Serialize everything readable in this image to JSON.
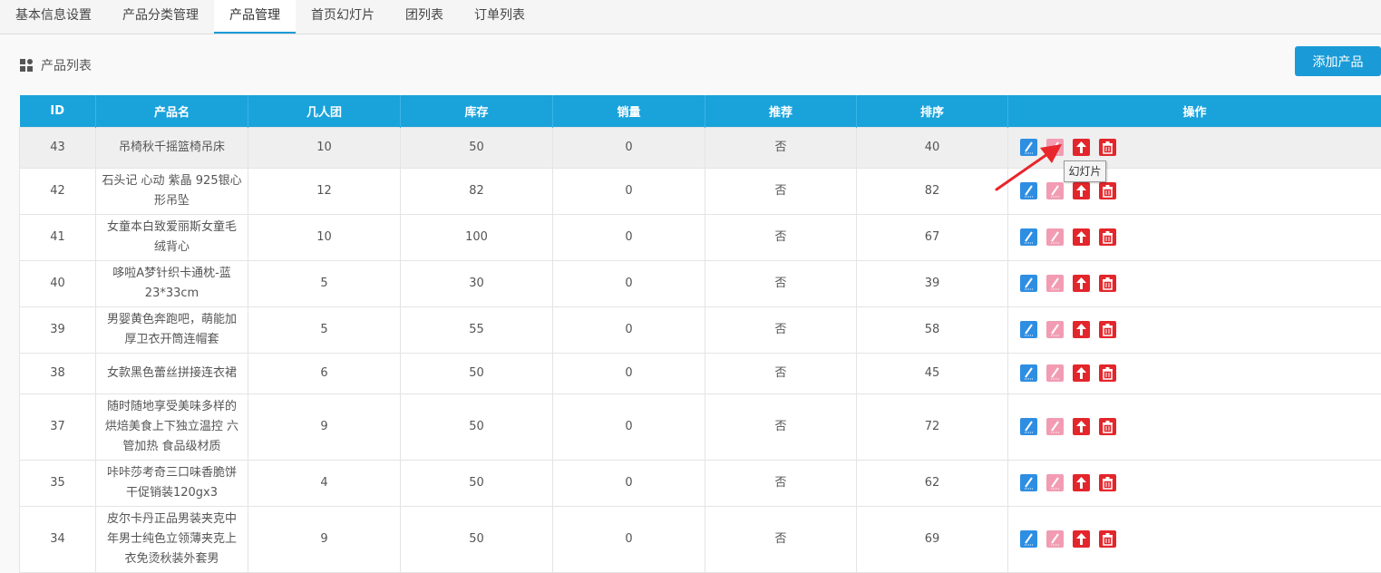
{
  "tabs": [
    {
      "label": "基本信息设置",
      "active": false
    },
    {
      "label": "产品分类管理",
      "active": false
    },
    {
      "label": "产品管理",
      "active": true
    },
    {
      "label": "首页幻灯片",
      "active": false
    },
    {
      "label": "团列表",
      "active": false
    },
    {
      "label": "订单列表",
      "active": false
    }
  ],
  "section": {
    "title": "产品列表",
    "add_label": "添加产品"
  },
  "table": {
    "headers": [
      "ID",
      "产品名",
      "几人团",
      "库存",
      "销量",
      "推荐",
      "排序",
      "操作"
    ],
    "rows": [
      {
        "id": "43",
        "name": "吊椅秋千摇篮椅吊床",
        "group": "10",
        "stock": "50",
        "sales": "0",
        "recommend": "否",
        "sort": "40"
      },
      {
        "id": "42",
        "name": "石头记 心动 紫晶 925银心形吊坠",
        "group": "12",
        "stock": "82",
        "sales": "0",
        "recommend": "否",
        "sort": "82"
      },
      {
        "id": "41",
        "name": "女童本白致爱丽斯女童毛绒背心",
        "group": "10",
        "stock": "100",
        "sales": "0",
        "recommend": "否",
        "sort": "67"
      },
      {
        "id": "40",
        "name": "哆啦A梦针织卡通枕-蓝23*33cm",
        "group": "5",
        "stock": "30",
        "sales": "0",
        "recommend": "否",
        "sort": "39"
      },
      {
        "id": "39",
        "name": "男婴黄色奔跑吧，萌能加厚卫衣开筒连帽套",
        "group": "5",
        "stock": "55",
        "sales": "0",
        "recommend": "否",
        "sort": "58"
      },
      {
        "id": "38",
        "name": "女款黑色蕾丝拼接连衣裙",
        "group": "6",
        "stock": "50",
        "sales": "0",
        "recommend": "否",
        "sort": "45"
      },
      {
        "id": "37",
        "name": "随时随地享受美味多样的烘焙美食上下独立温控 六管加热 食品级材质",
        "group": "9",
        "stock": "50",
        "sales": "0",
        "recommend": "否",
        "sort": "72"
      },
      {
        "id": "35",
        "name": "咔咔莎考奇三口味香脆饼干促销装120gx3",
        "group": "4",
        "stock": "50",
        "sales": "0",
        "recommend": "否",
        "sort": "62"
      },
      {
        "id": "34",
        "name": "皮尔卡丹正品男装夹克中年男士纯色立领薄夹克上衣免烫秋装外套男",
        "group": "9",
        "stock": "50",
        "sales": "0",
        "recommend": "否",
        "sort": "69"
      }
    ]
  },
  "tooltip": "幻灯片",
  "icons": {
    "edit": "edit-icon",
    "slide": "slideshow-icon",
    "top": "arrow-up-icon",
    "delete": "trash-icon"
  },
  "colors": {
    "accent": "#1aa3db",
    "edit": "#2e8ee2",
    "slide": "#f29cb3",
    "danger": "#e3262b",
    "arrow": "#e8262b"
  }
}
